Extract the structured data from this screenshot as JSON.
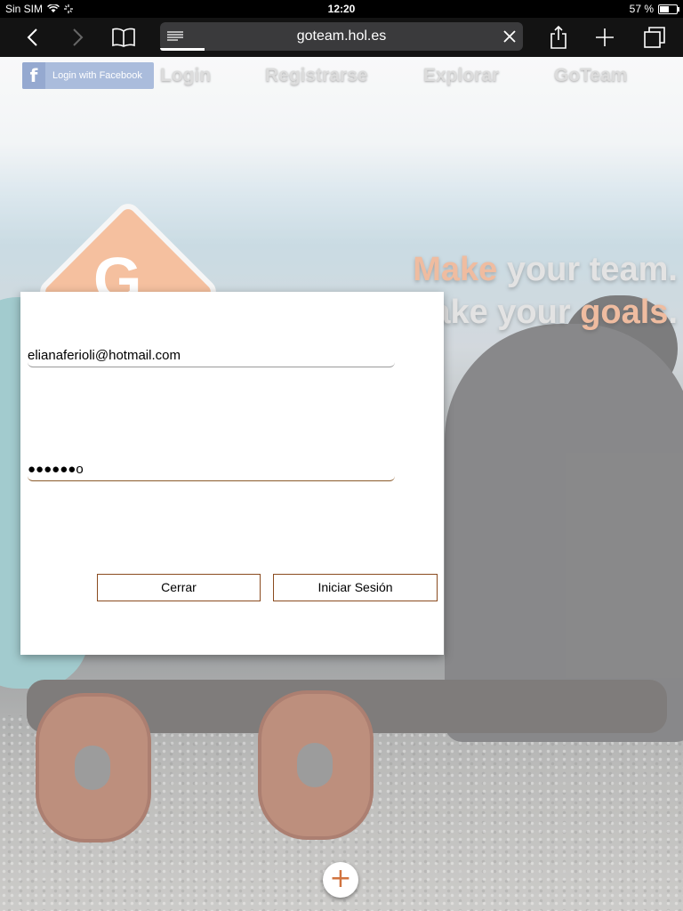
{
  "status_bar": {
    "carrier": "Sin SIM",
    "time": "12:20",
    "battery": "57 %",
    "battery_level": 0.57
  },
  "browser": {
    "url": "goteam.hol.es"
  },
  "page": {
    "facebook_login_label": "Login with Facebook",
    "facebook_icon_glyph": "f",
    "nav": [
      "Login",
      "Registrarse",
      "Explorar",
      "GoTeam"
    ],
    "logo_letter": "G",
    "tagline_line1": {
      "word1": "Make",
      "rest": " your team."
    },
    "tagline_line2": {
      "word1": "ake your ",
      "accent": "goals",
      "end": "."
    },
    "add_button_glyph": "+"
  },
  "login_modal": {
    "email_value": "elianaferioli@hotmail.com",
    "password_value": "●●●●●●o",
    "close_label": "Cerrar",
    "submit_label": "Iniciar Sesión"
  },
  "colors": {
    "accent": "#e9a27c",
    "button_border": "#8a4b1f",
    "facebook": "#8aa3cf"
  }
}
